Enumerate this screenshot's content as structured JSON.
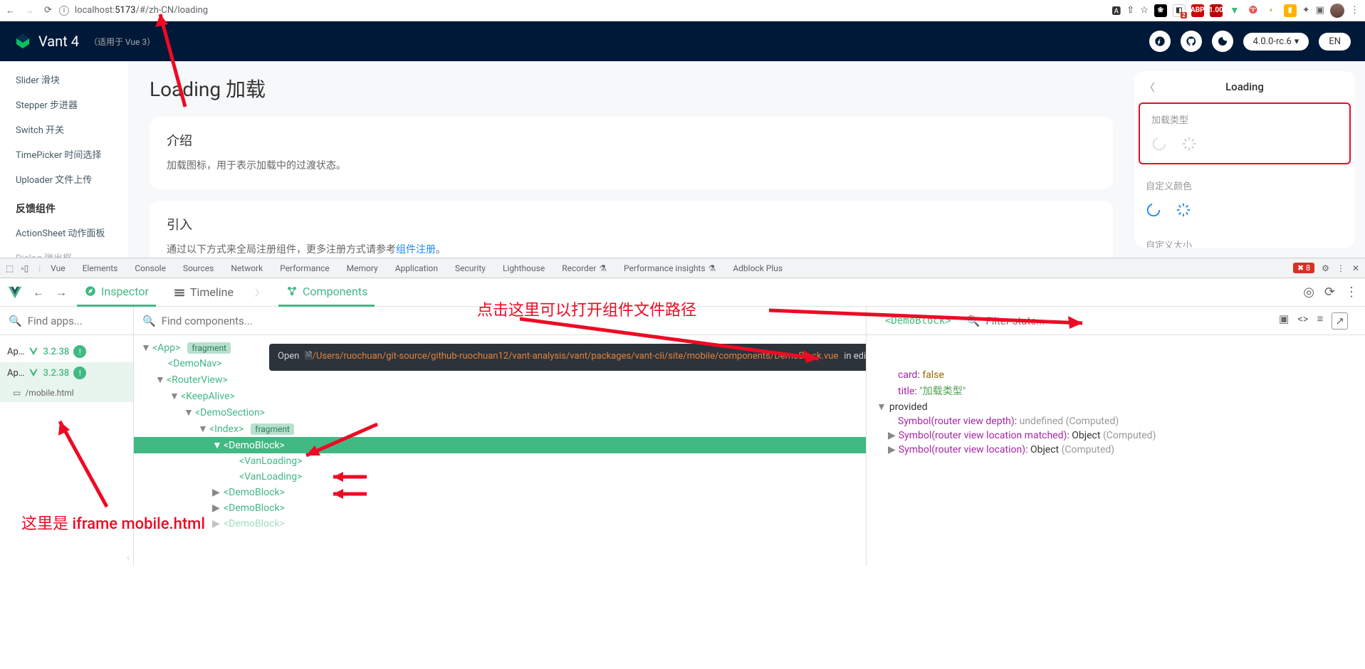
{
  "browser": {
    "url_host": "localhost:",
    "url_port": "5173",
    "url_path": "/#/zh-CN/loading",
    "ext_icons": [
      "⎘",
      "⇪",
      "☆"
    ],
    "ext_badges": [
      {
        "bg": "#000",
        "txt": "❀"
      },
      {
        "bg": "#d00",
        "txt": "2"
      },
      {
        "bg": "#c00",
        "txt": "ABP"
      },
      {
        "bg": "#b00",
        "txt": "1.00"
      },
      {
        "bg": "#41b883",
        "txt": "V"
      },
      {
        "bg": "#fff",
        "txt": "♈"
      },
      {
        "bg": "#8bc34a",
        "txt": "◐"
      },
      {
        "bg": "#ffb300",
        "txt": "▮"
      },
      {
        "bg": "#555",
        "txt": "✦"
      },
      {
        "bg": "#555",
        "txt": "▣"
      }
    ]
  },
  "vant": {
    "title": "Vant 4",
    "subtitle": "（适用于 Vue 3）",
    "version": "4.0.0-rc.6",
    "lang": "EN",
    "sidebar": {
      "items": [
        "Slider 滑块",
        "Stepper 步进器",
        "Switch 开关",
        "TimePicker 时间选择",
        "Uploader 文件上传"
      ],
      "group": "反馈组件",
      "group_items": [
        "ActionSheet 动作面板",
        "Dialog 弹出框"
      ]
    },
    "page_title": "Loading 加载",
    "intro_h": "介绍",
    "intro_p": "加载图标，用于表示加载中的过渡状态。",
    "usage_h": "引入",
    "usage_p_prefix": "通过以下方式来全局注册组件，更多注册方式请参考",
    "usage_link": "组件注册",
    "usage_p_suffix": "。",
    "preview": {
      "title": "Loading",
      "sec1": "加载类型",
      "sec2": "自定义颜色",
      "sec3": "自定义大小"
    }
  },
  "annotations": {
    "top": "点击这里可以打开组件文件路径",
    "bottom": "这里是 iframe mobile.html"
  },
  "devtools": {
    "tabs": [
      "Vue",
      "Elements",
      "Console",
      "Sources",
      "Network",
      "Performance",
      "Memory",
      "Application",
      "Security",
      "Lighthouse",
      "Recorder",
      "Performance insights",
      "Adblock Plus"
    ],
    "errors": "8"
  },
  "vue_dt": {
    "tools": {
      "inspector": "Inspector",
      "timeline": "Timeline",
      "components": "Components"
    },
    "search_apps": "Find apps...",
    "search_components": "Find components...",
    "filter_state": "Filter state...",
    "selected_comp": "<DemoBlock>",
    "apps": {
      "a1": "Ap…",
      "a2": "Ap…",
      "ver": "3.2.38",
      "path": "/mobile.html"
    },
    "tree": {
      "app": "App",
      "fragment": "fragment",
      "demonav": "DemoNav",
      "routerview": "RouterView",
      "keepalive": "KeepAlive",
      "demosection": "DemoSection",
      "index": "Index",
      "demoblock": "DemoBlock",
      "vanloading": "VanLoading"
    },
    "tooltip_open": "Open",
    "tooltip_path": "/Users/ruochuan/git-source/github-ruochuan12/vant-analysis/vant/packages/vant-cli/site/mobile/components/DemoBlock.vue",
    "tooltip_suffix": "in editor",
    "state": {
      "card_key": "card",
      "card_val": "false",
      "title_key": "title",
      "title_val": "\"加载类型\"",
      "provided": "provided",
      "sym1": "Symbol(router view depth)",
      "sym1_val": "undefined",
      "computed": "(Computed)",
      "sym2": "Symbol(router view location matched)",
      "sym2_val": "Object",
      "sym3": "Symbol(router view location)",
      "sym3_val": "Object"
    }
  }
}
